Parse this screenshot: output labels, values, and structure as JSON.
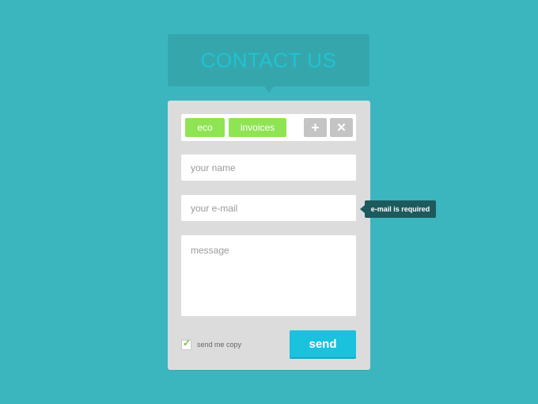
{
  "header": {
    "title": "CONTACT US"
  },
  "tags": {
    "items": [
      {
        "label": "eco"
      },
      {
        "label": "invoices"
      }
    ],
    "add_symbol": "+",
    "remove_symbol": "✕"
  },
  "form": {
    "name_placeholder": "your name",
    "email_placeholder": "your e-mail",
    "message_placeholder": "message",
    "send_copy_label": "send me copy",
    "send_copy_checked": true,
    "send_label": "send"
  },
  "tooltip": {
    "text": "e-mail is required"
  },
  "colors": {
    "background": "#3bb6bf",
    "header_bg": "#36a6ad",
    "header_text": "#1fc3d3",
    "tag": "#8fe453",
    "send_button": "#1ac2de",
    "tooltip_bg": "#1d5a5d"
  }
}
